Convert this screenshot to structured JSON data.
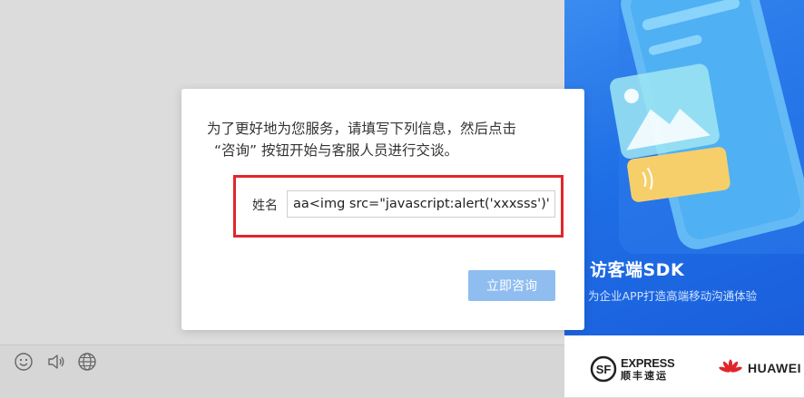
{
  "modal": {
    "intro_line1": "为了更好地为您服务，请填写下列信息，然后点击",
    "intro_line2": "“咨询” 按钮开始与客服人员进行交谈。",
    "name_label": "姓名",
    "name_value": "aa<img src=\"javascript:alert('xxxsss')\">",
    "submit_label": "立即咨询"
  },
  "promo": {
    "title": "访客端SDK",
    "subtitle": "为企业APP打造高端移动沟通体验"
  },
  "logos": {
    "sf_express": "EXPRESS",
    "sf_cn": "顺丰速运",
    "huawei": "HUAWEI"
  },
  "toolbar": {
    "icons": [
      "smiley-icon",
      "speaker-icon",
      "globe-icon"
    ]
  },
  "colors": {
    "highlight": "#e0262b",
    "button": "#8fbdf0",
    "promo_blue": "#1f6fe6"
  }
}
